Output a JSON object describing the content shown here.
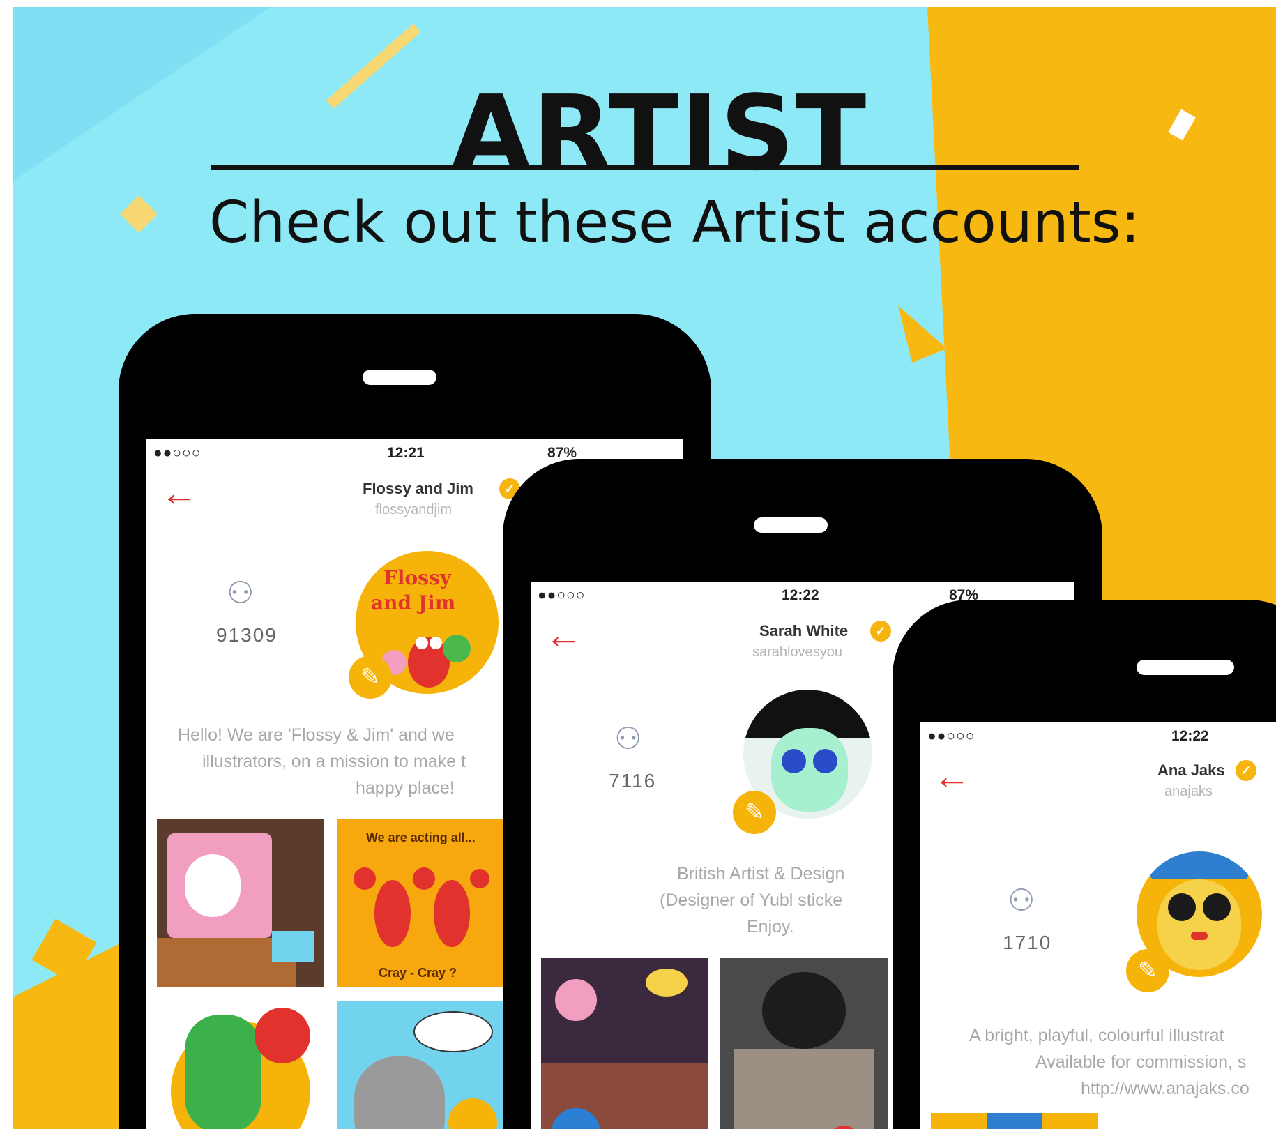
{
  "colors": {
    "cyan": "#8ee9f7",
    "yellow": "#f8b812",
    "black": "#000000",
    "red": "#e2322e"
  },
  "header": {
    "title": "ARTIST",
    "subtitle": "Check out these Artist accounts:"
  },
  "phones": [
    {
      "status": {
        "signal": "●●○○○",
        "time": "12:21",
        "battery": "87%"
      },
      "name": "Flossy and Jim",
      "handle": "flossyandjim",
      "followers": "91309",
      "avatar_text": [
        "Flossy",
        "and Jim"
      ],
      "bio": [
        "Hello! We are 'Flossy & Jim' and we",
        "illustrators, on a mission to make t",
        "happy place!"
      ],
      "tile_texts": [
        "We are acting all...",
        "Cray - Cray ?"
      ]
    },
    {
      "status": {
        "signal": "●●○○○",
        "time": "12:22",
        "battery": "87%"
      },
      "name": "Sarah White",
      "handle": "sarahlovesyou",
      "followers": "7116",
      "bio": [
        "British Artist & Design",
        "(Designer of Yubl sticke",
        "Enjoy."
      ]
    },
    {
      "status": {
        "signal": "●●○○○",
        "time": "12:22"
      },
      "name": "Ana Jaks",
      "handle": "anajaks",
      "followers": "1710",
      "bio": [
        "A bright, playful, colourful illustrat",
        "Available for commission, s",
        "http://www.anajaks.co"
      ]
    }
  ]
}
